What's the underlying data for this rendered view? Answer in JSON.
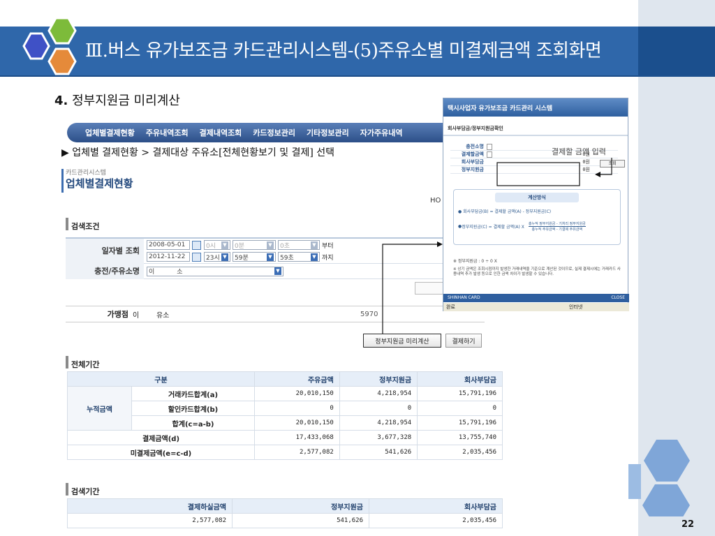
{
  "slide": {
    "title": "Ⅲ.버스 유가보조금 카드관리시스템-(5)주유소별 미결제금액 조회화면",
    "subtitle_num": "4.",
    "subtitle_text": " 정부지원금 미리계산",
    "instruction": "▶ 업체별 결제현황 > 결제대상 주유소[전체현황보기 및 결제] 선택",
    "page_number": "22",
    "accent_color": "#2f67aa"
  },
  "nav": {
    "items": [
      "업체별결제현황",
      "주유내역조회",
      "결제내역조회",
      "카드정보관리",
      "기타정보관리",
      "자가주유내역"
    ]
  },
  "page": {
    "breadcrumb": "카드관리시스템",
    "heading": "업체별결제현황",
    "home_label": "HO"
  },
  "search": {
    "section_title": "검색조건",
    "date_label": "일자별 조회",
    "from_date": "2008-05-01",
    "from_hour": "0시",
    "from_min": "0분",
    "from_sec": "0초",
    "from_suffix": "부터",
    "to_date": "2012-11-22",
    "to_hour": "23시",
    "to_min": "59분",
    "to_sec": "59초",
    "to_suffix": "까지",
    "station_label": "충전/주유소명",
    "station_value": "이",
    "station_value2": "소"
  },
  "shop": {
    "label": "가맹점",
    "value1": "이",
    "value2": "유소",
    "value3": "5970"
  },
  "buttons": {
    "precalc": "정부지원금 미리계산",
    "pay": "결제하기"
  },
  "total_period": {
    "section_title": "전체기간",
    "headers": [
      "구분",
      "주유금액",
      "정부지원금",
      "회사부담금"
    ],
    "group_label": "누적금액",
    "rows": [
      {
        "label": "거래카드합계(a)",
        "fuel": "20,010,150",
        "gov": "4,218,954",
        "company": "15,791,196"
      },
      {
        "label": "할인카드합계(b)",
        "fuel": "0",
        "gov": "0",
        "company": "0"
      },
      {
        "label": "합계(c=a-b)",
        "fuel": "20,010,150",
        "gov": "4,218,954",
        "company": "15,791,196"
      }
    ],
    "paid": {
      "label": "결제금액(d)",
      "fuel": "17,433,068",
      "gov": "3,677,328",
      "company": "13,755,740"
    },
    "unpaid": {
      "label": "미결제금액(e=c-d)",
      "fuel": "2,577,082",
      "gov": "541,626",
      "company": "2,035,456"
    }
  },
  "search_period": {
    "section_title": "검색기간",
    "headers": [
      "결제하실금액",
      "정부지원금",
      "회사부담금"
    ],
    "values": [
      "2,577,082",
      "541,626",
      "2,035,456"
    ]
  },
  "popup": {
    "title": "택시사업자 유가보조금 카드관리 시스템",
    "subtitle": "회사부담금/정부지원금확인",
    "rows": [
      {
        "label": "충전소명",
        "value": ""
      },
      {
        "label": "결제할금액",
        "value": "0원"
      },
      {
        "label": "회사부담금",
        "value": "0원"
      },
      {
        "label": "정부지원금",
        "value": "0원"
      }
    ],
    "lookup_button": "조회",
    "calc_title": "계산방식",
    "formula1": "회사부담금(B) = 결제할 금액(A) - 정부지원금(C)",
    "formula2": "정부지원금(C) = 결제할 금액(A) X",
    "formula2_num": "총누적 정부지원금 - 기처리 정부지원금",
    "formula2_den": "총누적 주유금액 - 기결제 주유금액",
    "note1": "※ 정부지원금 : 0 ÷ 0 X",
    "note2": "※ 상기 금액은 조회시점까지 발생한 거래내역을 기준으로 계산된 것이므로, 실제 결제시에는 거래카드 사용내역 추가 발생 등으로 인한 금액 차이가 발생할 수 있습니다.",
    "footer_brand": "SHINHAN CARD",
    "footer_close": "CLOSE",
    "status_left": "완료",
    "status_right": "인터넷"
  },
  "callout": {
    "text": "결제할 금액 입력"
  }
}
